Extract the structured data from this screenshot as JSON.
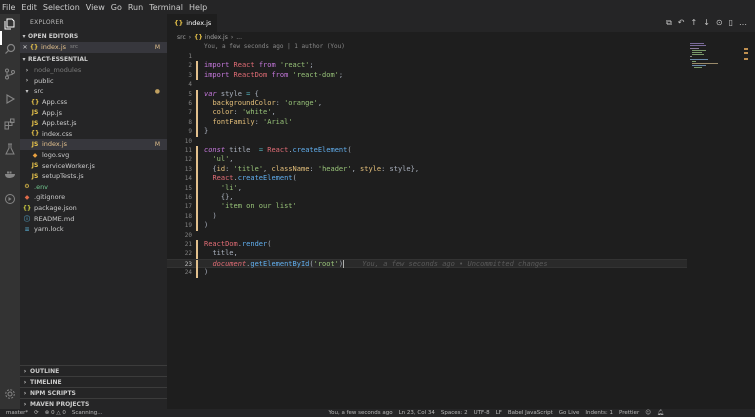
{
  "menu": [
    "File",
    "Edit",
    "Selection",
    "View",
    "Go",
    "Run",
    "Terminal",
    "Help"
  ],
  "activity_icons": [
    "files-icon",
    "search-icon",
    "source-control-icon",
    "run-debug-icon",
    "extensions-icon",
    "test-icon",
    "docker-icon",
    "live-share-icon"
  ],
  "sidebar": {
    "title": "EXPLORER",
    "open_editors_header": "OPEN EDITORS",
    "open_editor": {
      "close": "✕",
      "icon": "{}",
      "name": "index.js",
      "dir": "src",
      "badge": "M"
    },
    "project_header": "REACT-ESSENTIAL",
    "tree": [
      {
        "name": "node_modules",
        "type": "folder",
        "indent": 1,
        "state": "dim"
      },
      {
        "name": "public",
        "type": "folder",
        "indent": 1,
        "state": ""
      },
      {
        "name": "src",
        "type": "folder-open",
        "indent": 1,
        "state": "",
        "badge": "●"
      },
      {
        "name": "App.css",
        "type": "css",
        "indent": 2,
        "state": ""
      },
      {
        "name": "App.js",
        "type": "js",
        "indent": 2,
        "state": ""
      },
      {
        "name": "App.test.js",
        "type": "test",
        "indent": 2,
        "state": ""
      },
      {
        "name": "index.css",
        "type": "css",
        "indent": 2,
        "state": ""
      },
      {
        "name": "index.js",
        "type": "js",
        "indent": 2,
        "state": "mod",
        "badge": "M",
        "selected": true
      },
      {
        "name": "logo.svg",
        "type": "svg",
        "indent": 2,
        "state": ""
      },
      {
        "name": "serviceWorker.js",
        "type": "js",
        "indent": 2,
        "state": ""
      },
      {
        "name": "setupTests.js",
        "type": "js",
        "indent": 2,
        "state": ""
      },
      {
        "name": ".env",
        "type": "env",
        "indent": 1,
        "state": "untracked"
      },
      {
        "name": ".gitignore",
        "type": "git",
        "indent": 1,
        "state": ""
      },
      {
        "name": "package.json",
        "type": "json",
        "indent": 1,
        "state": ""
      },
      {
        "name": "README.md",
        "type": "md",
        "indent": 1,
        "state": ""
      },
      {
        "name": "yarn.lock",
        "type": "lock",
        "indent": 1,
        "state": ""
      }
    ],
    "bottom_sections": [
      "OUTLINE",
      "TIMELINE",
      "NPM SCRIPTS",
      "MAVEN PROJECTS"
    ]
  },
  "tab": {
    "icon": "{}",
    "label": "index.js"
  },
  "breadcrumb": {
    "folder": "src",
    "icon": "{}",
    "file": "index.js",
    "more": "..."
  },
  "codelens": "You, a few seconds ago | 1 author (You)",
  "blame": "You, a few seconds ago • Uncommitted changes",
  "status": {
    "branch": "master*",
    "sync": "⟳",
    "problems": "⊗ 0 △ 0",
    "scanning": "Scanning...",
    "author": "You, a few seconds ago",
    "position": "Ln 23, Col 34",
    "spaces": "Spaces: 2",
    "encoding": "UTF-8",
    "eol": "LF",
    "language": "Babel JavaScript",
    "golive": "Go Live",
    "indents": "Indents: 1",
    "prettier": "Prettier"
  },
  "colors": {
    "modified": "#e2c08d",
    "untracked": "#73c991",
    "keyword": "#c678dd",
    "string": "#98c379",
    "function": "#61afef"
  }
}
